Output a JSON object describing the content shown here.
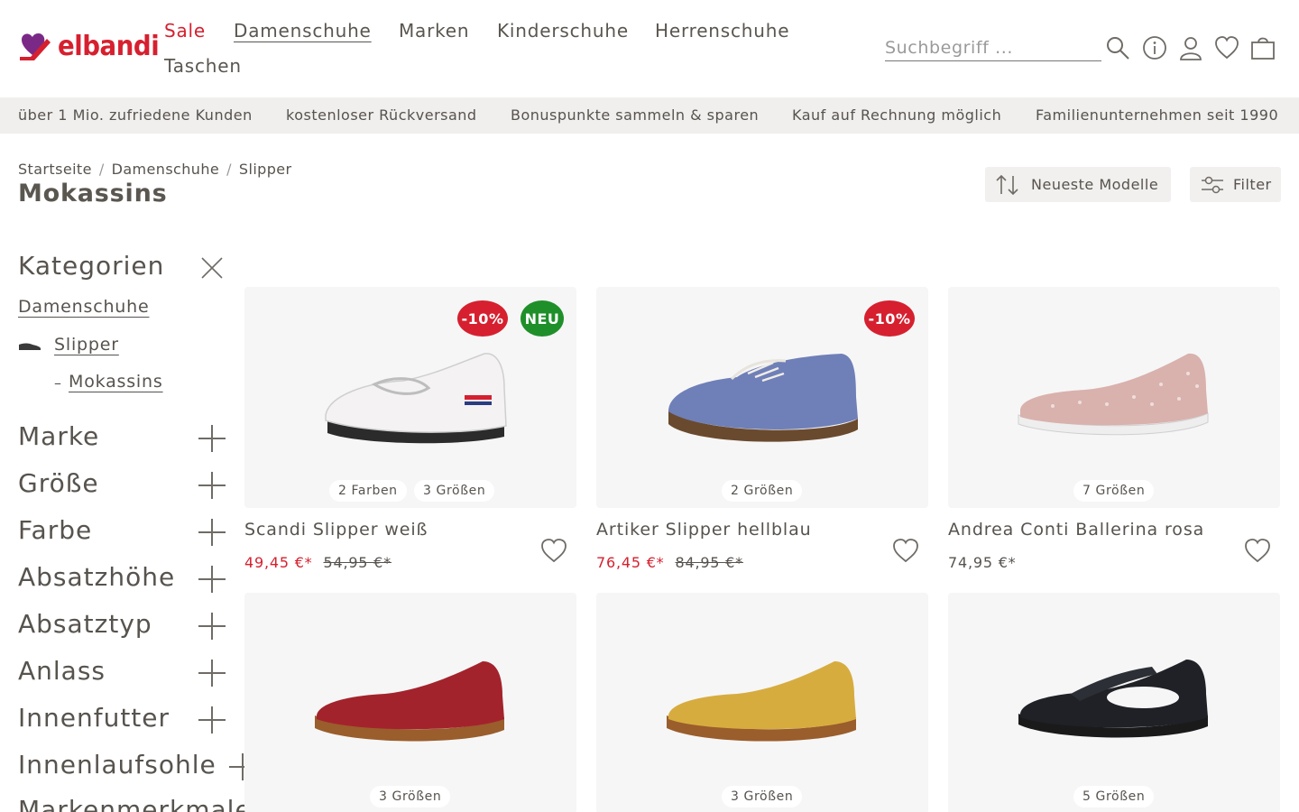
{
  "header": {
    "logo_text": "elbandi",
    "nav": [
      "Sale",
      "Damenschuhe",
      "Marken",
      "Kinderschuhe",
      "Herrenschuhe",
      "Taschen"
    ],
    "search_placeholder": "Suchbegriff ..."
  },
  "usp": [
    "über 1 Mio. zufriedene Kunden",
    "kostenloser Rückversand",
    "Bonuspunkte sammeln & sparen",
    "Kauf auf Rechnung möglich",
    "Familienunternehmen seit 1990"
  ],
  "breadcrumb": [
    "Startseite",
    "Damenschuhe",
    "Slipper"
  ],
  "page_title": "Mokassins",
  "toolbar": {
    "sort_label": "Neueste Modelle",
    "filter_label": "Filter"
  },
  "sidebar": {
    "categories_title": "Kategorien",
    "cat_level1": "Damenschuhe",
    "cat_level2": "Slipper",
    "cat_level3_prefix": "–",
    "cat_level3": "Mokassins",
    "filters": [
      "Marke",
      "Größe",
      "Farbe",
      "Absatzhöhe",
      "Absatztyp",
      "Anlass",
      "Innenfutter",
      "Innenlaufsohle",
      "Markenmerkmale"
    ]
  },
  "products": [
    {
      "name": "Scandi Slipper weiß",
      "price": "49,45 €*",
      "old_price": "54,95 €*",
      "badges": [
        "-10%",
        "NEU"
      ],
      "chips": [
        "2 Farben",
        "3 Größen"
      ],
      "colors": {
        "upper": "#f4f2f2",
        "sole": "#2b2b2b"
      }
    },
    {
      "name": "Artiker Slipper hellblau",
      "price": "76,45 €*",
      "old_price": "84,95 €*",
      "badges": [
        "-10%"
      ],
      "chips": [
        "2 Größen"
      ],
      "colors": {
        "upper": "#6f7fb8",
        "sole": "#6a4a2e"
      }
    },
    {
      "name": "Andrea Conti Ballerina rosa",
      "price": "74,95 €*",
      "old_price": "",
      "badges": [],
      "chips": [
        "7 Größen"
      ],
      "colors": {
        "upper": "#d9b1ad",
        "sole": "#eeeeee"
      }
    },
    {
      "chips": [
        "3 Größen"
      ],
      "colors": {
        "upper": "#a3232c",
        "sole": "#9a5d2c"
      }
    },
    {
      "chips": [
        "3 Größen"
      ],
      "colors": {
        "upper": "#d7ac3f",
        "sole": "#9a5d2c"
      }
    },
    {
      "chips": [
        "5 Größen"
      ],
      "colors": {
        "upper": "#1f2126",
        "sole": "#1a1a1a"
      }
    }
  ],
  "colors": {
    "brand_red": "#d6202f",
    "new_green": "#1f8f2a",
    "bar_bg": "#f0efee"
  }
}
